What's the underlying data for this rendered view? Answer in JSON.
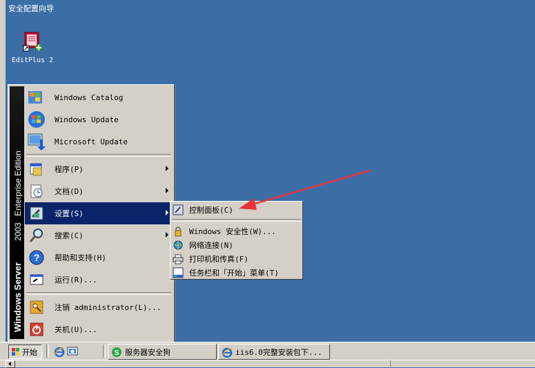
{
  "desktop": {
    "top_title": "安全配置向导",
    "icons": [
      {
        "label": "EditPlus 2",
        "icon": "editplus-icon"
      }
    ]
  },
  "start_menu": {
    "banner": {
      "brand": "Windows Server",
      "version": "2003",
      "edition": "Enterprise Edition"
    },
    "top_items": [
      {
        "label": "Windows Catalog",
        "icon": "windows-catalog-icon"
      },
      {
        "label": "Windows Update",
        "icon": "windows-update-icon"
      },
      {
        "label": "Microsoft Update",
        "icon": "microsoft-update-icon"
      }
    ],
    "items": [
      {
        "label": "程序(P)",
        "icon": "programs-icon",
        "submenu": true
      },
      {
        "label": "文档(D)",
        "icon": "documents-icon",
        "submenu": true
      },
      {
        "label": "设置(S)",
        "icon": "settings-icon",
        "submenu": true,
        "active": true
      },
      {
        "label": "搜索(C)",
        "icon": "search-icon",
        "submenu": true
      },
      {
        "label": "帮助和支持(H)",
        "icon": "help-icon"
      },
      {
        "label": "运行(R)...",
        "icon": "run-icon"
      }
    ],
    "bottom_items": [
      {
        "label": "注销 administrator(L)...",
        "icon": "logoff-icon"
      },
      {
        "label": "关机(U)...",
        "icon": "shutdown-icon"
      }
    ]
  },
  "settings_submenu": {
    "items": [
      {
        "label": "控制面板(C)",
        "icon": "control-panel-icon"
      },
      {
        "label": "Windows 安全性(W)...",
        "icon": "windows-security-icon"
      },
      {
        "label": "网络连接(N)",
        "icon": "network-connections-icon"
      },
      {
        "label": "打印机和传真(F)",
        "icon": "printers-faxes-icon"
      },
      {
        "label": "任务栏和「开始」菜单(T)",
        "icon": "taskbar-start-menu-icon"
      }
    ]
  },
  "annotation": {
    "color": "#e8333a"
  },
  "taskbar": {
    "start_label": "开始",
    "quick_launch": [
      {
        "icon": "ie-icon"
      },
      {
        "icon": "show-desktop-icon"
      }
    ],
    "tasks": [
      {
        "label": "服务器安全狗",
        "icon": "safedog-icon"
      },
      {
        "label": "iis6.0完整安装包下...",
        "icon": "ie-icon"
      }
    ]
  },
  "colors": {
    "desktop": "#3a6ea5",
    "menu_face": "#d4d0c8",
    "highlight": "#0a246a"
  }
}
